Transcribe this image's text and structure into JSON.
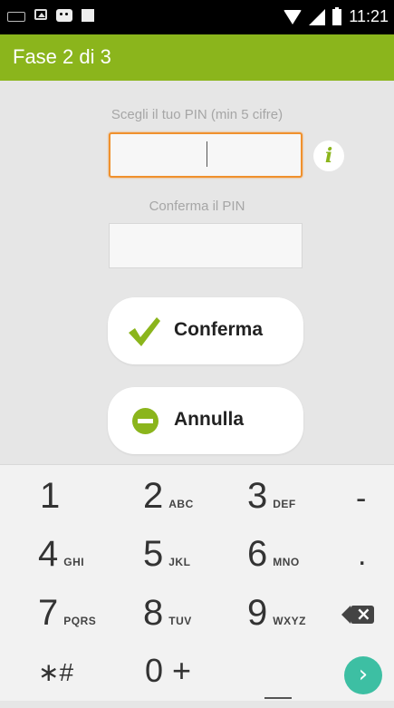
{
  "status_bar": {
    "time": "11:21",
    "icons": [
      "keyboard-icon",
      "image-icon",
      "chat-icon",
      "square-icon",
      "wifi-icon",
      "signal-icon",
      "battery-icon"
    ]
  },
  "app_bar": {
    "title": "Fase 2 di 3"
  },
  "form": {
    "pin_label": "Scegli il tuo PIN (min 5 cifre)",
    "pin_value": "",
    "confirm_label": "Conferma il PIN",
    "confirm_value": "",
    "info_icon": "i"
  },
  "buttons": {
    "confirm_label": "Conferma",
    "cancel_label": "Annulla"
  },
  "keypad": {
    "keys": [
      {
        "num": "1",
        "letters": ""
      },
      {
        "num": "2",
        "letters": "ABC"
      },
      {
        "num": "3",
        "letters": "DEF"
      },
      {
        "num": "-",
        "letters": ""
      },
      {
        "num": "4",
        "letters": "GHI"
      },
      {
        "num": "5",
        "letters": "JKL"
      },
      {
        "num": "6",
        "letters": "MNO"
      },
      {
        "num": ".",
        "letters": ""
      },
      {
        "num": "7",
        "letters": "PQRS"
      },
      {
        "num": "8",
        "letters": "TUV"
      },
      {
        "num": "9",
        "letters": "WXYZ"
      },
      {
        "num": "∗#",
        "letters": ""
      },
      {
        "num": "0 +",
        "letters": ""
      }
    ],
    "next_symbol": "›"
  },
  "colors": {
    "accent": "#8bb51c",
    "focus": "#f0912d",
    "next": "#3dbfa3"
  }
}
